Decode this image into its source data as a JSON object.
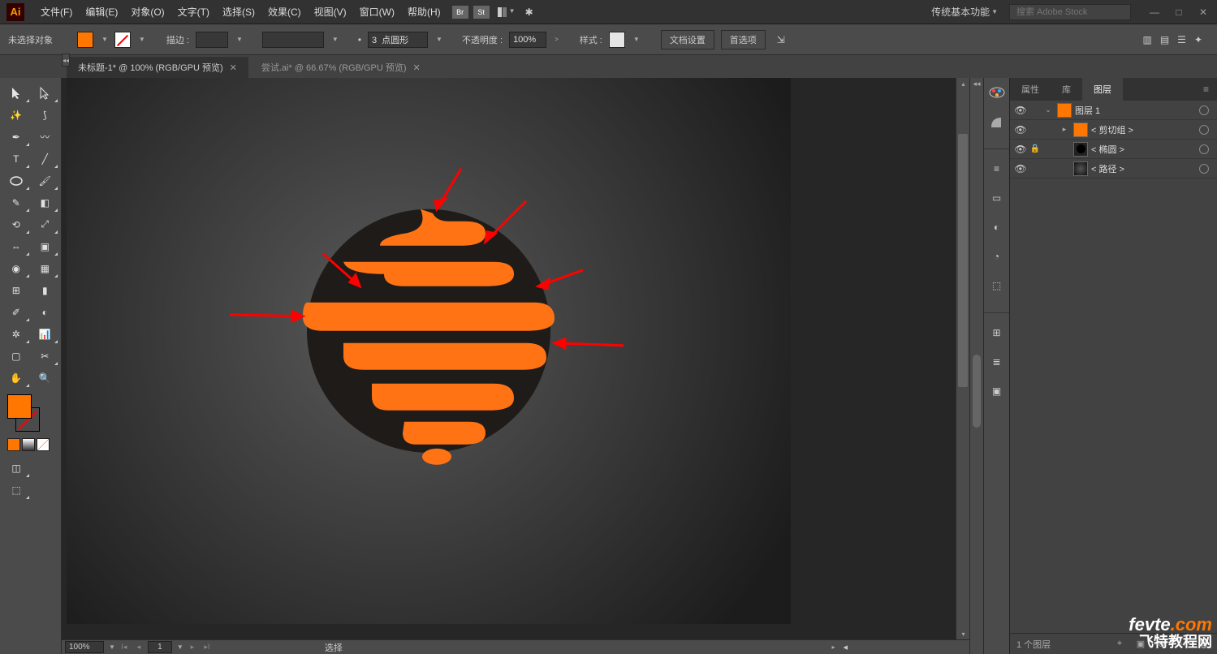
{
  "menu": {
    "items": [
      "文件(F)",
      "编辑(E)",
      "对象(O)",
      "文字(T)",
      "选择(S)",
      "效果(C)",
      "视图(V)",
      "窗口(W)",
      "帮助(H)"
    ],
    "br": "Br",
    "st": "St",
    "workspace": "传统基本功能",
    "search_placeholder": "搜索 Adobe Stock"
  },
  "control": {
    "no_selection": "未选择对象",
    "stroke_label": "描边 :",
    "stroke_weight": "",
    "stroke_style_label": "",
    "profile": "3  点圆形",
    "opacity_label": "不透明度 :",
    "opacity": "100%",
    "style_label": "样式 :",
    "doc_setup": "文档设置",
    "prefs": "首选项"
  },
  "tabs": [
    {
      "label": "未标题-1* @ 100% (RGB/GPU 预览)",
      "active": true
    },
    {
      "label": "尝试.ai* @ 66.67% (RGB/GPU 预览)",
      "active": false
    }
  ],
  "panel": {
    "tabs": [
      "属性",
      "库",
      "图层"
    ],
    "active_tab": 2,
    "layers": [
      {
        "name": "图层 1",
        "indent": 0,
        "expanded": true,
        "eye": true,
        "thumb": "orange"
      },
      {
        "name": "< 剪切组 >",
        "indent": 1,
        "expanded": false,
        "eye": true,
        "thumb": "orange"
      },
      {
        "name": "< 椭圆 >",
        "indent": 1,
        "expanded": false,
        "eye": true,
        "lock": true,
        "thumb": "circle"
      },
      {
        "name": "< 路径 >",
        "indent": 1,
        "expanded": false,
        "eye": true,
        "thumb": "grad"
      }
    ],
    "footer_count": "1 个图层"
  },
  "status": {
    "zoom": "100%",
    "page": "1",
    "mode": "选择"
  },
  "watermark": {
    "top_a": "fevte",
    "top_b": ".com",
    "bottom": "飞特教程网"
  }
}
